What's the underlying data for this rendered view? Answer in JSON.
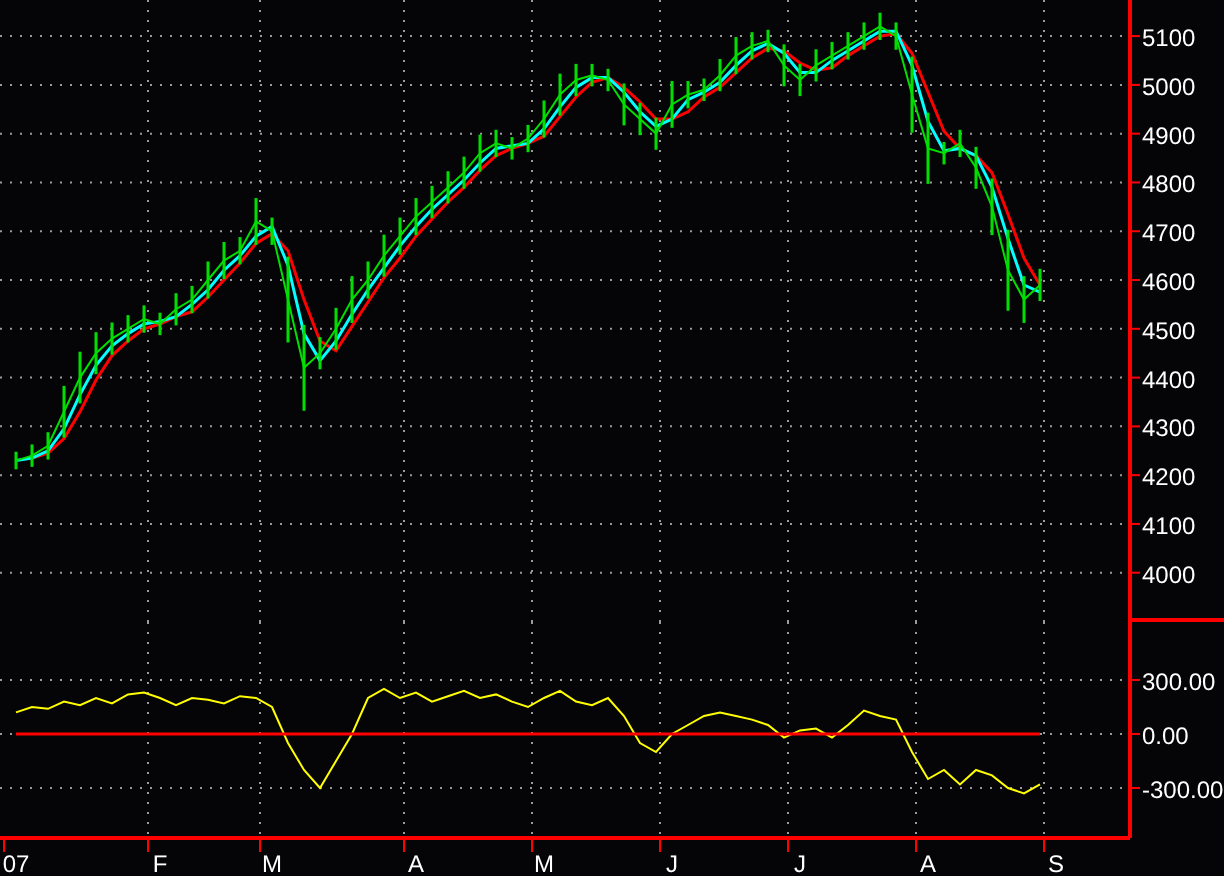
{
  "price_chart": {
    "chart_data": {
      "type": "line",
      "ylim": [
        3899,
        5174
      ],
      "grid": true,
      "yticks": [
        {
          "value": 4000,
          "label": "4000"
        },
        {
          "value": 4100,
          "label": "4100"
        },
        {
          "value": 4200,
          "label": "4200"
        },
        {
          "value": 4300,
          "label": "4300"
        },
        {
          "value": 4400,
          "label": "4400"
        },
        {
          "value": 4500,
          "label": "4500"
        },
        {
          "value": 4600,
          "label": "4600"
        },
        {
          "value": 4700,
          "label": "4700"
        },
        {
          "value": 4800,
          "label": "4800"
        },
        {
          "value": 4900,
          "label": "4900"
        },
        {
          "value": 5000,
          "label": "5000"
        },
        {
          "value": 5100,
          "label": "5100"
        }
      ],
      "series": [
        {
          "color": "#00e000",
          "values": [
            4230,
            4240,
            4260,
            4330,
            4400,
            4450,
            4480,
            4500,
            4520,
            4510,
            4540,
            4560,
            4600,
            4640,
            4660,
            4720,
            4700,
            4560,
            4420,
            4450,
            4500,
            4560,
            4600,
            4650,
            4690,
            4730,
            4760,
            4790,
            4820,
            4860,
            4880,
            4870,
            4890,
            4930,
            4980,
            5010,
            5020,
            5010,
            4960,
            4930,
            4900,
            4960,
            4980,
            4990,
            5020,
            5060,
            5080,
            5090,
            5040,
            5010,
            5040,
            5060,
            5080,
            5100,
            5120,
            5100,
            4980,
            4870,
            4860,
            4880,
            4830,
            4750,
            4620,
            4560,
            4590
          ],
          "errors": [
            18,
            23,
            28,
            53,
            53,
            43,
            33,
            28,
            28,
            23,
            33,
            28,
            38,
            38,
            28,
            48,
            28,
            88,
            88,
            33,
            43,
            48,
            38,
            43,
            38,
            38,
            33,
            33,
            33,
            38,
            28,
            23,
            28,
            38,
            43,
            33,
            23,
            23,
            43,
            33,
            33,
            48,
            28,
            23,
            33,
            38,
            28,
            23,
            43,
            33,
            33,
            28,
            28,
            28,
            28,
            28,
            78,
            73,
            23,
            28,
            43,
            58,
            83,
            48,
            33
          ]
        },
        {
          "color": "#00ffff",
          "values": [
            4230,
            4235,
            4250,
            4295,
            4365,
            4425,
            4465,
            4490,
            4510,
            4515,
            4525,
            4550,
            4580,
            4620,
            4650,
            4690,
            4710,
            4630,
            4490,
            4435,
            4475,
            4530,
            4580,
            4625,
            4670,
            4710,
            4745,
            4775,
            4805,
            4840,
            4870,
            4875,
            4880,
            4910,
            4955,
            4995,
            5015,
            5015,
            4985,
            4945,
            4915,
            4930,
            4970,
            4985,
            5005,
            5040,
            5070,
            5085,
            5065,
            5025,
            5025,
            5050,
            5070,
            5090,
            5110,
            5110,
            5040,
            4925,
            4865,
            4870,
            4855,
            4790,
            4685,
            4590,
            4575
          ]
        },
        {
          "color": "#ff0000",
          "values": [
            null,
            4235,
            4245,
            4275,
            4330,
            4395,
            4445,
            4475,
            4500,
            4510,
            4525,
            4535,
            4565,
            4600,
            4635,
            4675,
            4695,
            4660,
            4560,
            4475,
            4455,
            4505,
            4555,
            4605,
            4645,
            4690,
            4725,
            4760,
            4790,
            4825,
            4855,
            4870,
            4880,
            4895,
            4935,
            4975,
            5005,
            5015,
            4995,
            4965,
            4930,
            4930,
            4945,
            4975,
            4995,
            5025,
            5055,
            5075,
            5070,
            5045,
            5030,
            5035,
            5060,
            5080,
            5100,
            5105,
            5065,
            4985,
            4905,
            4870,
            4855,
            4820,
            4735,
            4645,
            4590
          ]
        }
      ]
    }
  },
  "oscillator_chart": {
    "chart_data": {
      "type": "line",
      "ylim": [
        -578,
        622
      ],
      "grid": true,
      "categories": [
        "07",
        null,
        null,
        null,
        null,
        null,
        null,
        null,
        null,
        "F",
        null,
        null,
        null,
        null,
        null,
        null,
        "M",
        null,
        null,
        null,
        null,
        null,
        null,
        null,
        null,
        "A",
        null,
        null,
        null,
        null,
        null,
        null,
        null,
        "M",
        null,
        null,
        null,
        null,
        null,
        null,
        null,
        "J",
        null,
        null,
        null,
        null,
        null,
        null,
        null,
        "J",
        null,
        null,
        null,
        null,
        null,
        null,
        null,
        "A",
        null,
        null,
        null,
        null,
        null,
        null,
        null,
        "S",
        null,
        null,
        null,
        null
      ],
      "yticks": [
        {
          "value": 300,
          "label": "300.00"
        },
        {
          "value": 0,
          "label": "0.00"
        },
        {
          "value": -300,
          "label": "-300.00"
        }
      ],
      "series": [
        {
          "color": "#ffff00",
          "values": [
            120,
            150,
            140,
            180,
            160,
            200,
            170,
            220,
            230,
            200,
            160,
            200,
            190,
            170,
            210,
            200,
            150,
            -50,
            -200,
            -300,
            -150,
            0,
            200,
            250,
            200,
            230,
            180,
            210,
            240,
            200,
            220,
            180,
            150,
            200,
            240,
            180,
            160,
            200,
            100,
            -50,
            -100,
            0,
            50,
            100,
            120,
            100,
            80,
            50,
            -20,
            20,
            30,
            -20,
            50,
            130,
            100,
            80,
            -100,
            -250,
            -200,
            -280,
            -200,
            -230,
            -300,
            -330,
            -280,
            null,
            null,
            null,
            null,
            null
          ]
        },
        {
          "color": "#ff0000",
          "values": [
            0,
            0,
            0,
            0,
            0,
            0,
            0,
            0,
            0,
            0,
            0,
            0,
            0,
            0,
            0,
            0,
            0,
            0,
            0,
            0,
            0,
            0,
            0,
            0,
            0,
            0,
            0,
            0,
            0,
            0,
            0,
            0,
            0,
            0,
            0,
            0,
            0,
            0,
            0,
            0,
            0,
            0,
            0,
            0,
            0,
            0,
            0,
            0,
            0,
            0,
            0,
            0,
            0,
            0,
            0,
            0,
            0,
            0,
            0,
            0,
            0,
            0,
            0,
            0,
            0,
            null,
            null,
            null,
            null,
            null
          ]
        }
      ]
    }
  }
}
